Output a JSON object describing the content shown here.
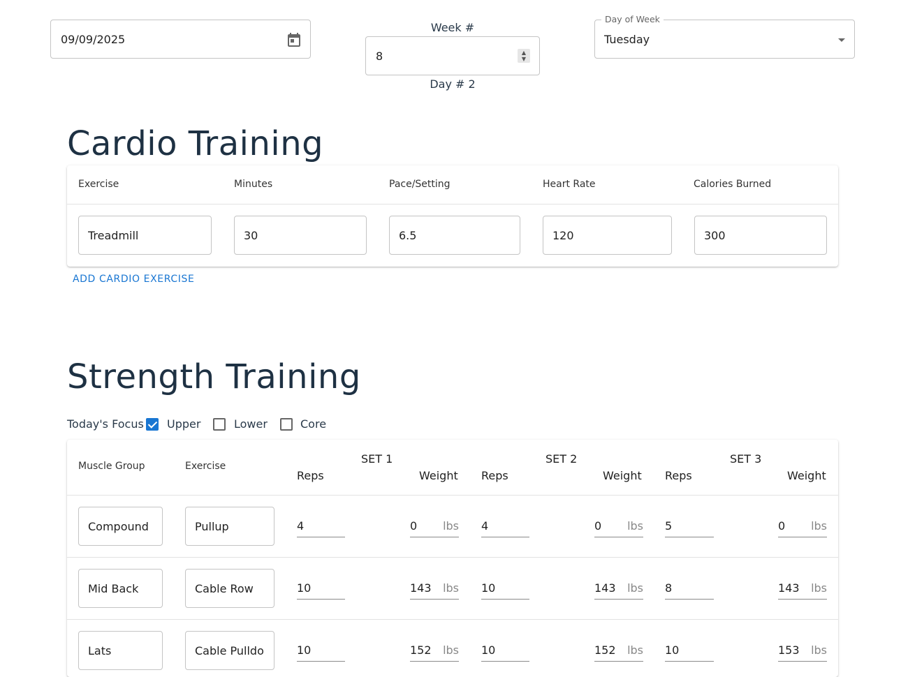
{
  "header": {
    "date_value": "09/09/2025",
    "week_label": "Week #",
    "week_value": "8",
    "day_label": "Day # 2",
    "dow_legend": "Day of Week",
    "dow_value": "Tuesday"
  },
  "cardio": {
    "title": "Cardio Training",
    "columns": [
      "Exercise",
      "Minutes",
      "Pace/Setting",
      "Heart Rate",
      "Calories Burned"
    ],
    "row": [
      "Treadmill",
      "30",
      "6.5",
      "120",
      "300"
    ],
    "add_label": "ADD CARDIO EXERCISE"
  },
  "strength": {
    "title": "Strength Training",
    "focus_label": "Today's Focus",
    "focus": [
      {
        "label": "Upper",
        "checked": true
      },
      {
        "label": "Lower",
        "checked": false
      },
      {
        "label": "Core",
        "checked": false
      }
    ],
    "col_muscle": "Muscle Group",
    "col_exercise": "Exercise",
    "sets": [
      "SET 1",
      "SET 2",
      "SET 3"
    ],
    "reps_label": "Reps",
    "weight_label": "Weight",
    "unit": "lbs",
    "rows": [
      {
        "muscle": "Compound",
        "exercise": "Pullup",
        "sets": [
          [
            "4",
            "0"
          ],
          [
            "4",
            "0"
          ],
          [
            "5",
            "0"
          ]
        ]
      },
      {
        "muscle": "Mid Back",
        "exercise": "Cable Row",
        "sets": [
          [
            "10",
            "143"
          ],
          [
            "10",
            "143"
          ],
          [
            "8",
            "143"
          ]
        ]
      },
      {
        "muscle": "Lats",
        "exercise": "Cable Pulldo",
        "sets": [
          [
            "10",
            "152"
          ],
          [
            "10",
            "152"
          ],
          [
            "10",
            "153"
          ]
        ]
      }
    ]
  }
}
